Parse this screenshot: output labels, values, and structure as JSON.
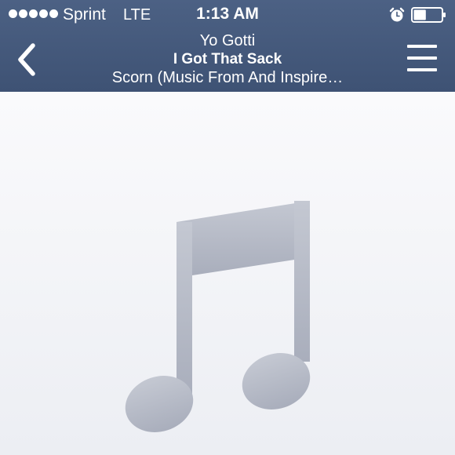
{
  "status_bar": {
    "carrier": "Sprint",
    "network": "LTE",
    "time": "1:13 AM",
    "signal_bars": 5,
    "battery_level": 0.45,
    "icons": [
      "signal-dots-icon",
      "alarm-icon",
      "battery-icon"
    ]
  },
  "now_playing": {
    "artist": "Yo Gotti",
    "song": "I Got That Sack",
    "album": "Scorn (Music From And Inspire…"
  },
  "nav": {
    "back_icon": "chevron-left-icon",
    "menu_icon": "hamburger-menu-icon"
  },
  "artwork": {
    "placeholder_icon": "music-note-icon"
  },
  "colors": {
    "header_bg": "#455a7d",
    "text": "#ffffff",
    "artwork_bg": "#f2f3f7",
    "note": "#b4b8c4"
  }
}
